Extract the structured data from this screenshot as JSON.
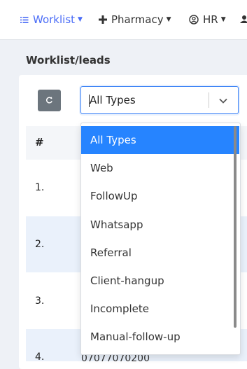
{
  "nav": {
    "worklist_label": "Worklist",
    "pharmacy_label": "Pharmacy",
    "hr_label": "HR",
    "accent_color": "#4a6cf7"
  },
  "page": {
    "section_title": "Worklist/leads"
  },
  "filter": {
    "selected_value": "All Types",
    "options": [
      "All Types",
      "Web",
      "FollowUp",
      "Whatsapp",
      "Referral",
      "Client-hangup",
      "Incomplete",
      "Manual-follow-up"
    ],
    "highlight_color": "#2684ff"
  },
  "table": {
    "header_hash": "#",
    "rows": [
      {
        "num": "1."
      },
      {
        "num": "2."
      },
      {
        "num": "3."
      },
      {
        "num": "4.",
        "partial_text": "07077070200"
      }
    ]
  }
}
